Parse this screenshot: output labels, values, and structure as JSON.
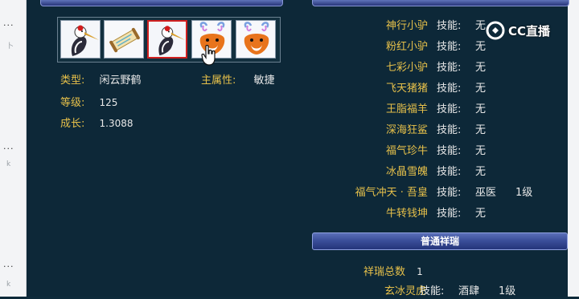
{
  "watermark": {
    "logo_text": "CC直播"
  },
  "left_strip": {
    "marks": [
      "...",
      "卜",
      "...",
      "k",
      "...",
      "k"
    ]
  },
  "pet_info": {
    "type_label": "类型:",
    "type_value": "闲云野鹤",
    "attr_label": "主属性:",
    "attr_value": "敏捷",
    "level_label": "等级:",
    "level_value": "125",
    "growth_label": "成长:",
    "growth_value": "1.3088"
  },
  "mounts": [
    {
      "name": "神行小驴",
      "skill_label": "技能:",
      "skill": "无",
      "level": ""
    },
    {
      "name": "粉红小驴",
      "skill_label": "技能:",
      "skill": "无",
      "level": ""
    },
    {
      "name": "七彩小驴",
      "skill_label": "技能:",
      "skill": "无",
      "level": ""
    },
    {
      "name": "飞天猪猪",
      "skill_label": "技能:",
      "skill": "无",
      "level": ""
    },
    {
      "name": "王脂福羊",
      "skill_label": "技能:",
      "skill": "无",
      "level": ""
    },
    {
      "name": "深海狂鲨",
      "skill_label": "技能:",
      "skill": "无",
      "level": ""
    },
    {
      "name": "福气珍牛",
      "skill_label": "技能:",
      "skill": "无",
      "level": ""
    },
    {
      "name": "冰晶雪魄",
      "skill_label": "技能:",
      "skill": "无",
      "level": ""
    },
    {
      "name": "福气冲天 · 吾皇",
      "skill_label": "技能:",
      "skill": "巫医",
      "level": "1级"
    },
    {
      "name": "牛转钱坤",
      "skill_label": "技能:",
      "skill": "无",
      "level": ""
    }
  ],
  "normal_xiangrui": {
    "header": "普通祥瑞",
    "total_label": "祥瑞总数",
    "total_value": "1",
    "items": [
      {
        "name": "玄冰灵虎",
        "skill_label": "技能:",
        "skill": "酒肆",
        "level": "1级"
      }
    ]
  },
  "pet_icons": [
    {
      "name": "crane-icon",
      "selected": false
    },
    {
      "name": "scroll-icon",
      "selected": false
    },
    {
      "name": "crane-icon",
      "selected": true
    },
    {
      "name": "deer-icon",
      "selected": false
    },
    {
      "name": "deer-icon",
      "selected": false
    }
  ]
}
